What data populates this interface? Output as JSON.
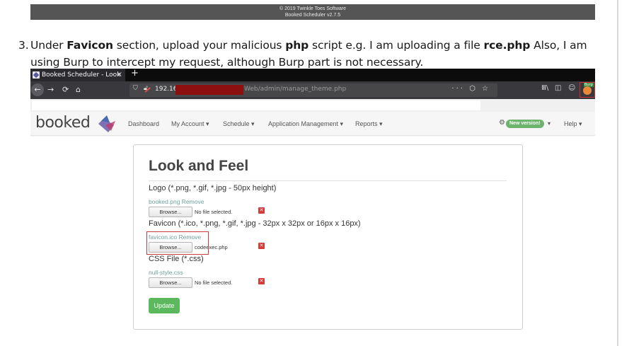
{
  "footer": {
    "line1": "© 2019 Twinkle Toes Software",
    "line2": "Booked Scheduler v2.7.5"
  },
  "step": {
    "number": "3.",
    "t1": "Under ",
    "b1": "Favicon",
    "t2": " section, upload your malicious ",
    "b2": "php",
    "t3": " script e.g. I am uploading a file ",
    "b3": "rce.php",
    "t4": " Also, I am using Burp to intercept my request, although Burp part is not necessary."
  },
  "browser": {
    "tab_title": "Booked Scheduler - Look",
    "tab_close": "×",
    "new_tab": "+",
    "back": "←",
    "forward": "→",
    "reload": "⟳",
    "home": "⌂",
    "url_host": "192.16",
    "url_path": "Web/admin/manage_theme.php",
    "url_right_icons": "··· ⬡ ☆",
    "library_icon": "Ⅲ\\",
    "sidebar_icon": "◫",
    "account_icon": "☺",
    "burp_label": "Burp"
  },
  "app": {
    "logo": "booked",
    "nav": {
      "dashboard": "Dashboard",
      "my_account": "My Account ▾",
      "schedule": "Schedule ▾",
      "app_mgmt": "Application Management ▾",
      "reports": "Reports ▾",
      "new_version": "New version!",
      "caret": "▾",
      "help": "Help ▾"
    },
    "page_title": "Look and Feel",
    "logo_section": {
      "label": "Logo (*.png, *.gif, *.jpg - 50px height)",
      "link": "booked.png Remove",
      "browse": "Browse...",
      "file": "No file selected."
    },
    "favicon_section": {
      "label": "Favicon (*.ico, *.png, *.gif, *.jpg - 32px x 32px or 16px x 16px)",
      "link": "favicon.ico Remove",
      "browse": "Browse...",
      "file": "codeexec.php"
    },
    "css_section": {
      "label": "CSS File (*.css)",
      "link": "null-style.css",
      "browse": "Browse...",
      "file": "No file selected."
    },
    "update": "Update",
    "remove_x": "✕"
  },
  "colors": {
    "accent_green": "#5cb85c",
    "highlight_red": "#c43c3c",
    "link": "#6fa0a0"
  }
}
